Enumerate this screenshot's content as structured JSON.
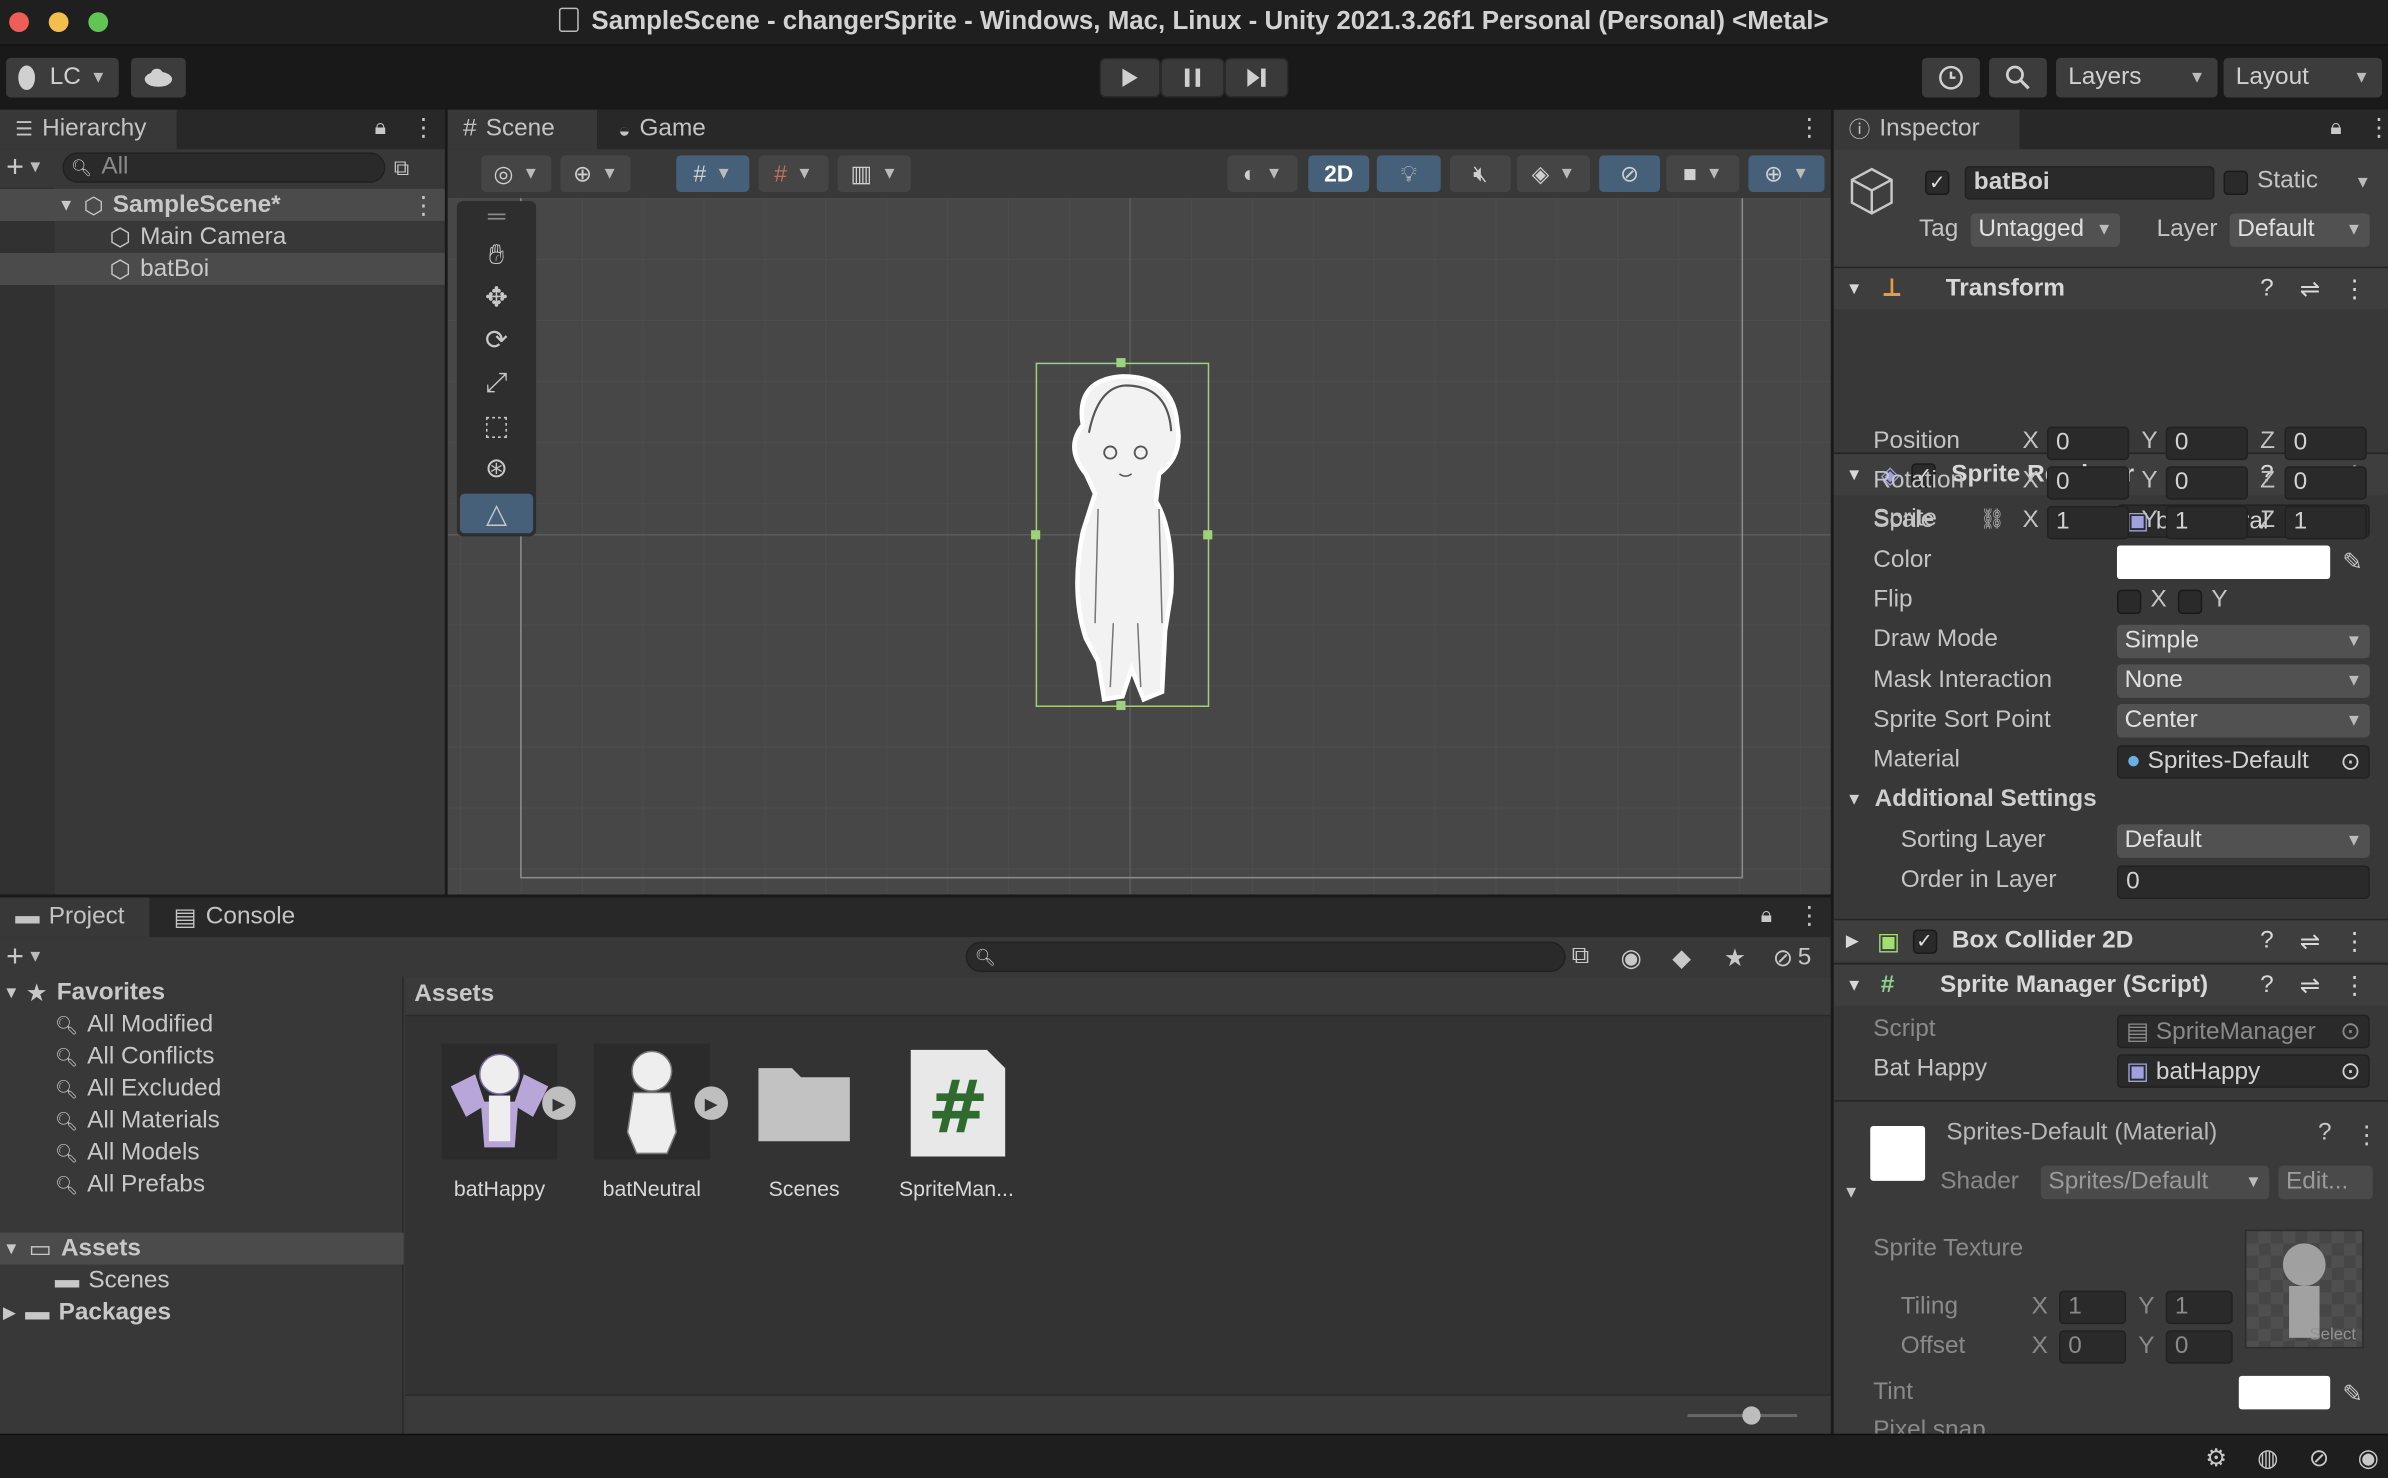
{
  "window": {
    "title": "SampleScene - changerSprite - Windows, Mac, Linux - Unity 2021.3.26f1 Personal (Personal) <Metal>"
  },
  "toolbar": {
    "account": "LC",
    "layers": "Layers",
    "layout": "Layout"
  },
  "hierarchy": {
    "tab": "Hierarchy",
    "search_placeholder": "All",
    "scene": "SampleScene*",
    "items": [
      "Main Camera",
      "batBoi"
    ]
  },
  "scene_view": {
    "tabs": [
      "Scene",
      "Game"
    ],
    "mode_2d": "2D"
  },
  "project": {
    "tabs": [
      "Project",
      "Console"
    ],
    "favorites": {
      "label": "Favorites",
      "items": [
        "All Modified",
        "All Conflicts",
        "All Excluded",
        "All Materials",
        "All Models",
        "All Prefabs"
      ]
    },
    "tree": {
      "assets": "Assets",
      "scenes": "Scenes",
      "packages": "Packages"
    },
    "breadcrumb": "Assets",
    "hidden_count": "5",
    "assets": [
      {
        "name": "batHappy"
      },
      {
        "name": "batNeutral"
      },
      {
        "name": "Scenes"
      },
      {
        "name": "SpriteMan..."
      }
    ]
  },
  "inspector": {
    "tab": "Inspector",
    "object_name": "batBoi",
    "static_label": "Static",
    "tag_label": "Tag",
    "tag": "Untagged",
    "layer_label": "Layer",
    "layer": "Default",
    "transform": {
      "title": "Transform",
      "position_label": "Position",
      "rotation_label": "Rotation",
      "scale_label": "Scale",
      "position": [
        "0",
        "0",
        "0"
      ],
      "rotation": [
        "0",
        "0",
        "0"
      ],
      "scale": [
        "1",
        "1",
        "1"
      ],
      "axes": [
        "X",
        "Y",
        "Z"
      ]
    },
    "sprite_renderer": {
      "title": "Sprite Renderer",
      "sprite_label": "Sprite",
      "sprite": "batNeutral",
      "color_label": "Color",
      "flip_label": "Flip",
      "flip_x": "X",
      "flip_y": "Y",
      "draw_mode_label": "Draw Mode",
      "draw_mode": "Simple",
      "mask_label": "Mask Interaction",
      "mask": "None",
      "sort_point_label": "Sprite Sort Point",
      "sort_point": "Center",
      "material_label": "Material",
      "material": "Sprites-Default",
      "additional": "Additional Settings",
      "sorting_layer_label": "Sorting Layer",
      "sorting_layer": "Default",
      "order_label": "Order in Layer",
      "order": "0"
    },
    "box_collider": {
      "title": "Box Collider 2D"
    },
    "sprite_manager": {
      "title": "Sprite Manager (Script)",
      "script_label": "Script",
      "script": "SpriteManager",
      "bat_happy_label": "Bat Happy",
      "bat_happy": "batHappy"
    },
    "material": {
      "title": "Sprites-Default (Material)",
      "shader_label": "Shader",
      "shader": "Sprites/Default",
      "edit": "Edit...",
      "texture_label": "Sprite Texture",
      "tiling_label": "Tiling",
      "offset_label": "Offset",
      "tiling": [
        "1",
        "1"
      ],
      "offset": [
        "0",
        "0"
      ],
      "select": "Select",
      "tint_label": "Tint",
      "pixel_snap_label": "Pixel snap"
    }
  },
  "colors": {
    "accent": "#2c5d87",
    "selection": "#4b4b4b",
    "panel": "#383838"
  }
}
